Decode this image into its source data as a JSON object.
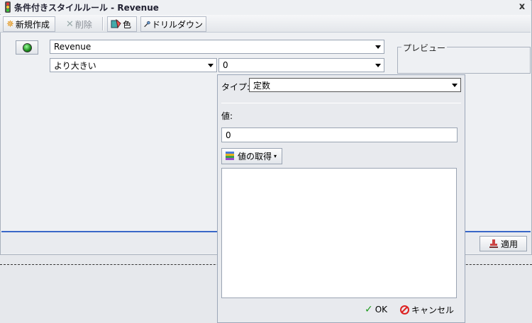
{
  "window": {
    "title": "条件付きスタイルルール - Revenue",
    "close": "x"
  },
  "toolbar": {
    "new_label": "新規作成",
    "delete_label": "削除",
    "color_label": "色",
    "drilldown_label": "ドリルダウン"
  },
  "form": {
    "field_value": "Revenue",
    "operator_value": "より大きい",
    "compare_value": "0",
    "preview_legend": "プレビュー"
  },
  "popup": {
    "type_label": "タイプ:",
    "type_value": "定数",
    "value_label": "値:",
    "value_input": "0",
    "get_value_label": "値の取得",
    "ok_label": "OK",
    "cancel_label": "キャンセル"
  },
  "bottom": {
    "apply_label": "適用"
  },
  "colors": {
    "accent_line": "#3a67c8",
    "window_bg": "#eef0f3"
  },
  "icons": [
    "traffic-light-icon",
    "new-star-icon",
    "delete-x-icon",
    "color-icon",
    "drilldown-icon",
    "status-led-icon",
    "database-icon",
    "check-icon",
    "cancel-icon",
    "apply-stamp-icon"
  ]
}
